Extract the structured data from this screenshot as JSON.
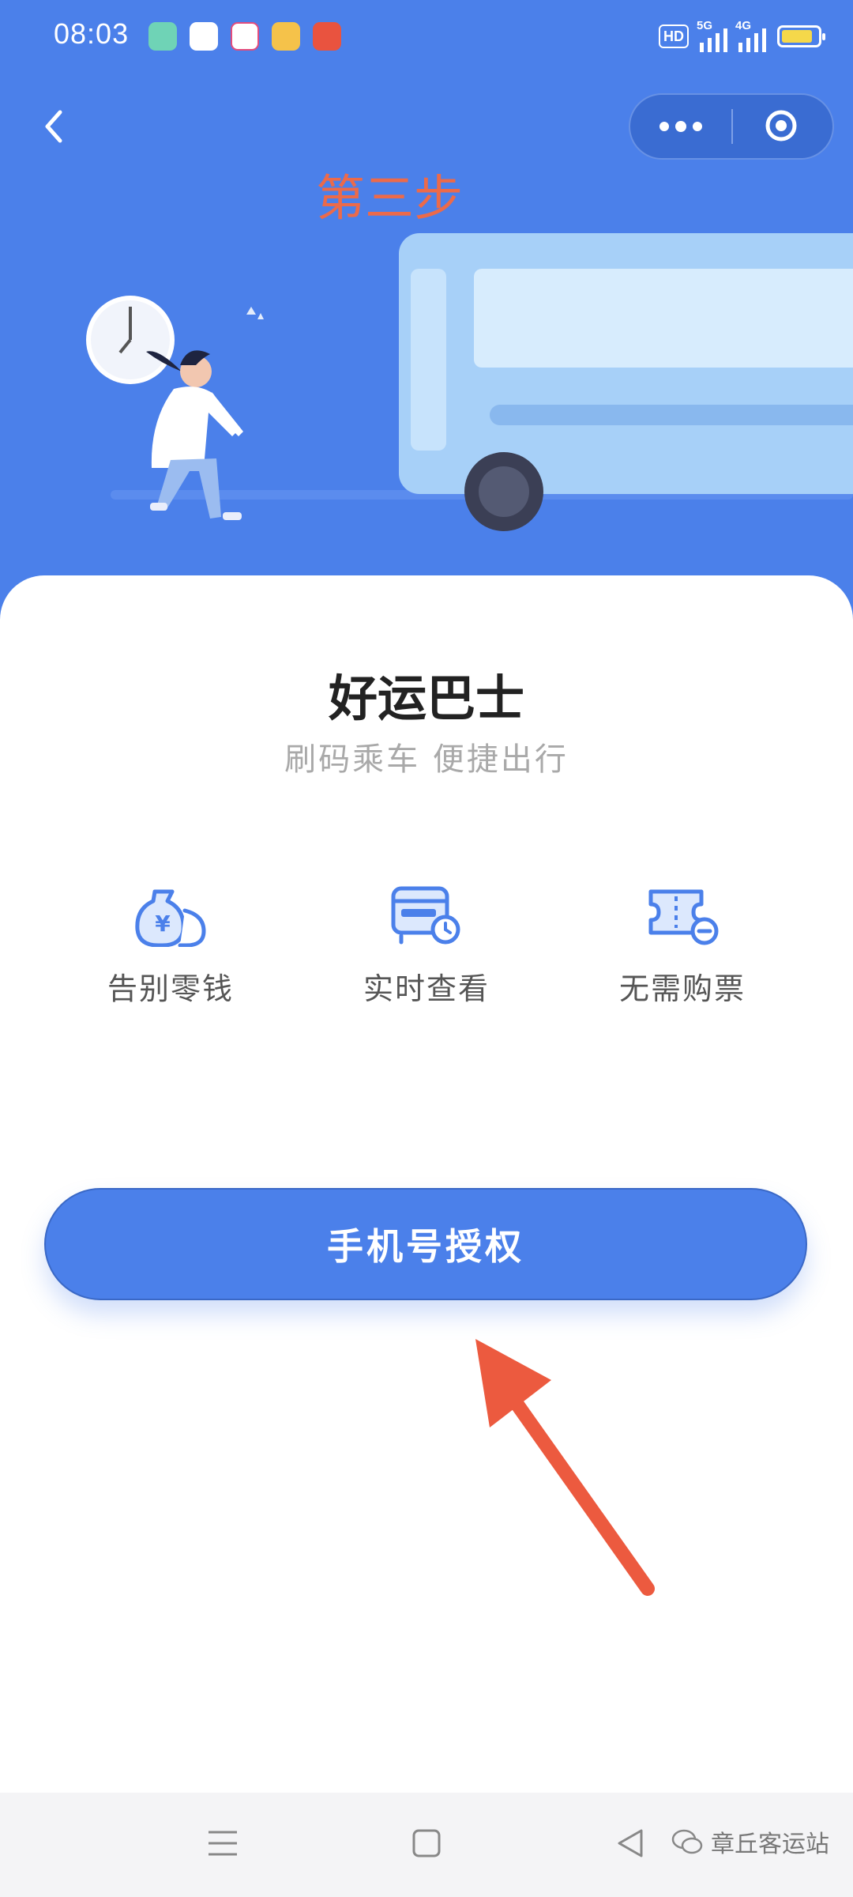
{
  "status_bar": {
    "time": "08:03",
    "hd_label": "HD",
    "signal_1_label": "5G",
    "signal_2_label": "4G"
  },
  "header": {
    "step_annotation": "第三步"
  },
  "main": {
    "title": "好运巴士",
    "subtitle": "刷码乘车 便捷出行",
    "features": [
      {
        "label": "告别零钱",
        "icon": "money-bag-icon"
      },
      {
        "label": "实时查看",
        "icon": "bus-clock-icon"
      },
      {
        "label": "无需购票",
        "icon": "ticket-icon"
      }
    ],
    "auth_button_label": "手机号授权"
  },
  "watermark": {
    "text": "章丘客运站"
  },
  "colors": {
    "primary": "#4b80ea",
    "annotation": "#ec6a4a",
    "card": "#ffffff"
  }
}
